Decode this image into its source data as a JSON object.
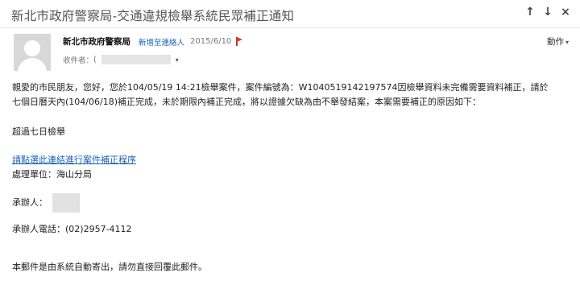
{
  "email": {
    "subject": "新北市政府警察局-交通違規檢舉系統民眾補正通知",
    "nav": {
      "prev_icon": "↑",
      "next_icon": "↓",
      "close_icon": "×"
    },
    "sender": {
      "name": "新北市政府警察局",
      "add_contact": "新增至連絡人",
      "date": "2015/6/10"
    },
    "recipient_label": "收件者：",
    "recipient_prefix": "(",
    "expand_icon": "▾",
    "action_label": "動作",
    "action_caret": "▾",
    "body": {
      "line1": "親愛的市民朋友，您好，您於104/05/19 14:21檢舉案件，案件編號為：W1040519142197574因檢舉資料未完備需要資料補正，請於",
      "line2": "七個日曆天內(104/06/18)補正完成，未於期限內補正完成，將以證據欠缺為由不舉發結案，本案需要補正的原因如下：",
      "reason": "超過七日檢舉",
      "link_text": "請點選此連結進行案件補正程序",
      "unit": "處理單位：海山分局",
      "handler_label": "承辦人：",
      "phone": "承辦人電話：(02)2957-4112",
      "footer": "本郵件是由系統自動寄出，請勿直接回覆此郵件。"
    }
  },
  "colors": {
    "link": "#1a5fb4",
    "flag": "#e03b24"
  }
}
